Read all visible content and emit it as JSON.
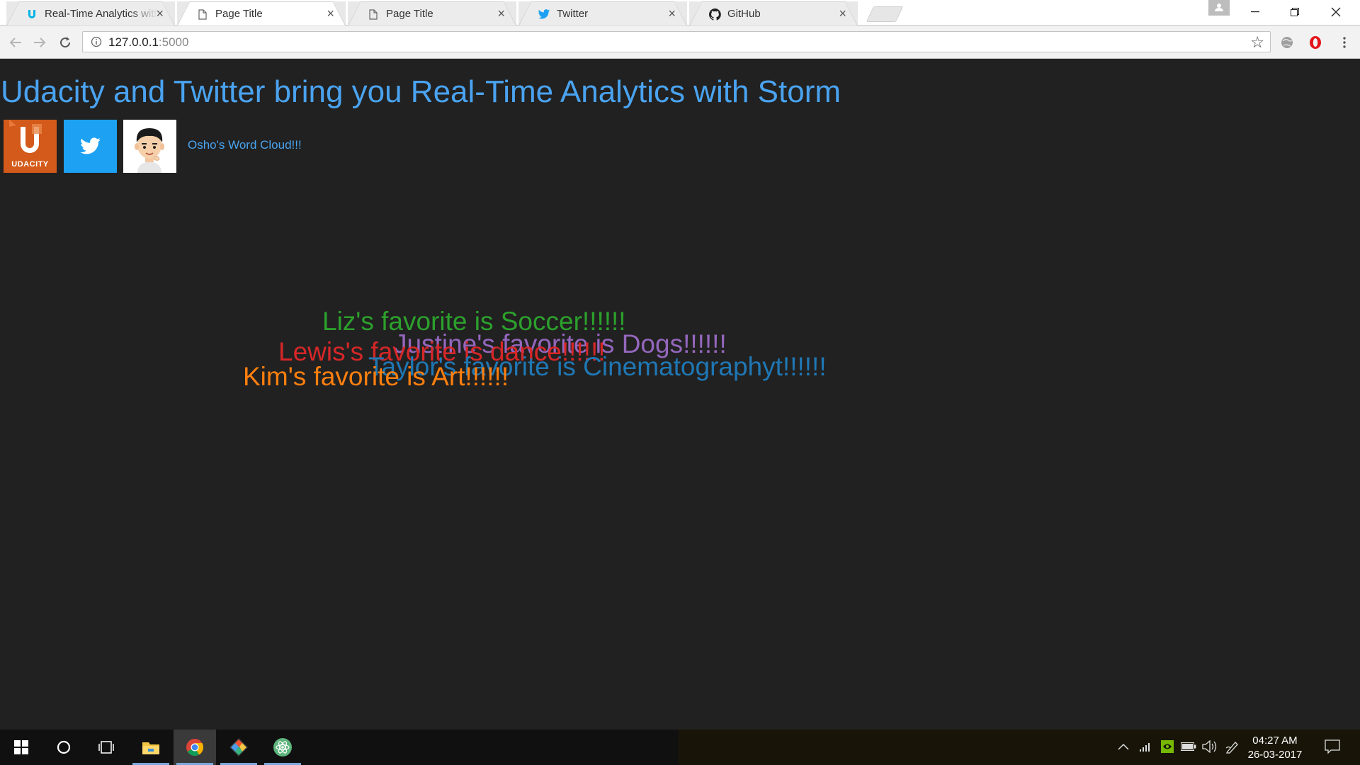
{
  "browser": {
    "tabs": [
      {
        "title": "Real-Time Analytics with",
        "icon": "udacity-favicon",
        "active": false
      },
      {
        "title": "Page Title",
        "icon": "page-icon",
        "active": true
      },
      {
        "title": "Page Title",
        "icon": "page-icon",
        "active": false
      },
      {
        "title": "Twitter",
        "icon": "twitter-favicon",
        "active": false
      },
      {
        "title": "GitHub",
        "icon": "github-favicon",
        "active": false
      }
    ],
    "close_glyph": "×",
    "address": {
      "host": "127.0.0.1",
      "port": ":5000"
    }
  },
  "page": {
    "heading": "Udacity and Twitter bring you Real-Time Analytics with Storm",
    "logos": {
      "udacity_text": "UDACITY"
    },
    "link_text": "Osho's Word Cloud!!!",
    "word_cloud": [
      {
        "text": "Liz's favorite is Soccer!!!!!!",
        "color": "#2ca02c"
      },
      {
        "text": "Justine's favorite is Dogs!!!!!!",
        "color": "#9467bd"
      },
      {
        "text": "Lewis's favorite is dance!!!!!!",
        "color": "#d62728"
      },
      {
        "text": "Taylor's favorite is Cinematographyt!!!!!!",
        "color": "#1f77b4"
      },
      {
        "text": "Kim's favorite is Art!!!!!!",
        "color": "#ff7f0e"
      }
    ]
  },
  "taskbar": {
    "apps": [
      "start-icon",
      "cortana-icon",
      "task-view-icon",
      "file-explorer-icon",
      "chrome-icon",
      "git-icon",
      "atom-icon"
    ],
    "clock": {
      "time": "04:27 AM",
      "date": "26-03-2017"
    }
  },
  "colors": {
    "page_bg": "#212121",
    "heading": "#4aa3f0",
    "twitter": "#1da1f2",
    "udacity": "#d35a1a"
  }
}
